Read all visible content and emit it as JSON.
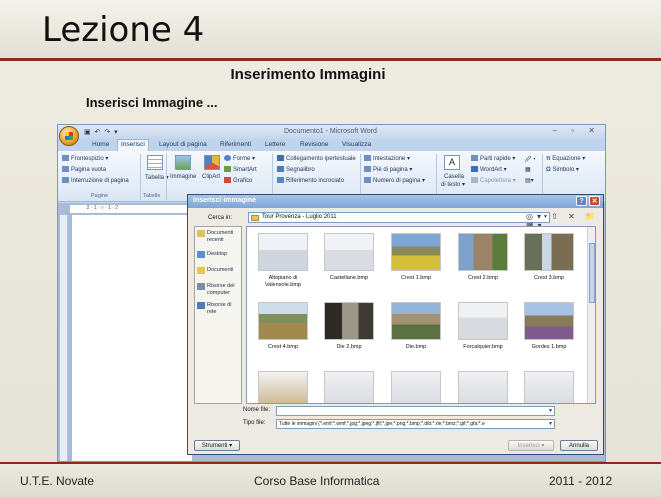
{
  "slide": {
    "title": "Lezione 4",
    "heading": "Inserimento Immagini",
    "subheading": "Inserisci Immagine ...",
    "footer_left": "U.T.E. Novate",
    "footer_center": "Corso Base Informatica",
    "footer_right": "2011 - 2012"
  },
  "word": {
    "window_title": "Documento1 - Microsoft Word",
    "tabs": [
      "Home",
      "Inserisci",
      "Layout di pagina",
      "Riferimenti",
      "Lettere",
      "Revisione",
      "Visualizza"
    ],
    "active_tab": "Inserisci",
    "ribbon": {
      "frontespizio": "Frontespizio",
      "pagina_vuota": "Pagina vuota",
      "interruzione": "Interruzione di pagina",
      "group_pagine": "Pagine",
      "tabella": "Tabella",
      "group_tabelle": "Tabelle",
      "immagine": "Immagine",
      "clipart": "ClipArt",
      "forme": "Forme",
      "smartart": "SmartArt",
      "grafico": "Grafico",
      "collegamento": "Collegamento ipertestuale",
      "segnalibro": "Segnalibro",
      "riferimento": "Riferimento incrociato",
      "intestazione": "Intestazione",
      "pie_pagina": "Piè di pagina",
      "numero_pagina": "Numero di pagina",
      "casella": "Casella",
      "di_testo": "di testo",
      "parti_rapide": "Parti rapide",
      "wordart": "WordArt",
      "capolettera": "Capolettera",
      "equazione": "Equazione",
      "simbolo": "Simbolo"
    }
  },
  "dialog": {
    "title": "Inserisci immagine",
    "look_in_label": "Cerca in:",
    "look_in_value": "Tour Provenza - Luglio 2011",
    "places": [
      "Documenti recenti",
      "Desktop",
      "Documenti",
      "Risorse del computer",
      "Risorse di rete"
    ],
    "files": [
      "Altopiano di Valensole.bmp",
      "Castellane.bmp",
      "Crest 1.bmp",
      "Crest 2.bmp",
      "Crest 3.bmp",
      "Crest 4.bmp",
      "Die 2.bmp",
      "Die.bmp",
      "Forcalquier.bmp",
      "Gordes 1.bmp"
    ],
    "filename_label": "Nome file:",
    "filename_value": "",
    "filetype_label": "Tipo file:",
    "filetype_value": "Tutte le immagini (*.emf;*.wmf;*.jpg;*.jpeg;*.jfif;*.jpe;*.png;*.bmp;*.dib;*.rle;*.bmz;*.gif;*.gfa;*.e",
    "tools_button": "Strumenti",
    "insert_button": "Inserisci",
    "cancel_button": "Annulla"
  }
}
